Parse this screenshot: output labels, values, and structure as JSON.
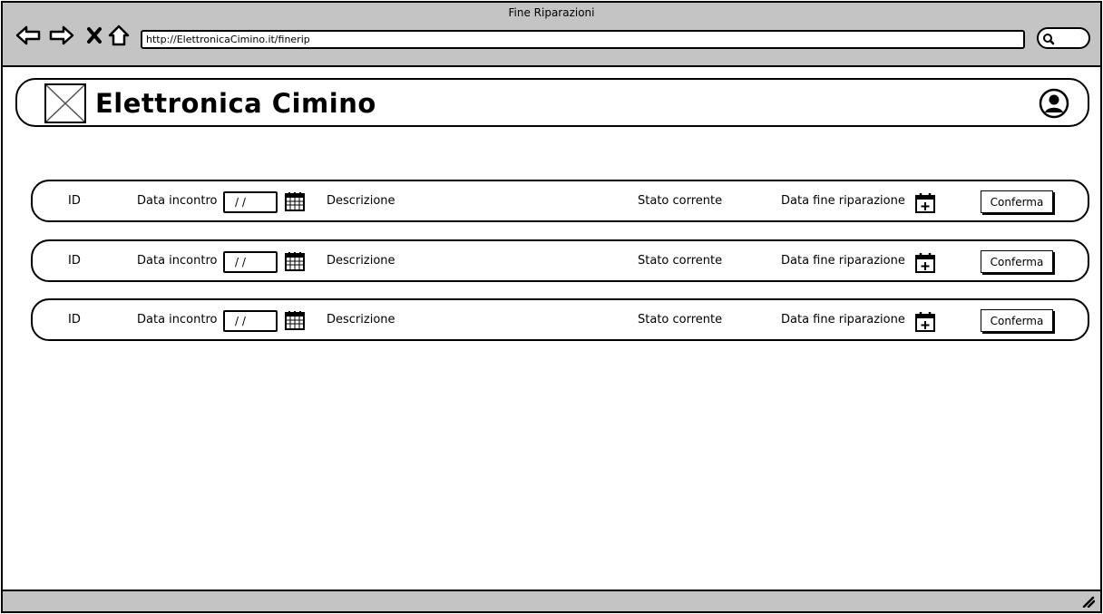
{
  "window": {
    "title": "Fine Riparazioni"
  },
  "browser": {
    "url": "http://ElettronicaCimino.it/finerip",
    "icons": [
      "back-arrow-icon",
      "forward-arrow-icon",
      "close-x-icon",
      "home-icon",
      "search-icon"
    ]
  },
  "header": {
    "brand": "Elettronica Cimino",
    "logo": "image-placeholder-icon",
    "user": "user-avatar-icon"
  },
  "rows": [
    {
      "id": "ID",
      "date_label": "Data incontro",
      "date_value": "/ /",
      "description": "Descrizione",
      "status": "Stato corrente",
      "end_date_label": "Data fine riparazione",
      "confirm": "Conferma"
    },
    {
      "id": "ID",
      "date_label": "Data incontro",
      "date_value": "/ /",
      "description": "Descrizione",
      "status": "Stato corrente",
      "end_date_label": "Data fine riparazione",
      "confirm": "Conferma"
    },
    {
      "id": "ID",
      "date_label": "Data incontro",
      "date_value": "/ /",
      "description": "Descrizione",
      "status": "Stato corrente",
      "end_date_label": "Data fine riparazione",
      "confirm": "Conferma"
    }
  ],
  "colors": {
    "chrome": "#c4c4c4",
    "ink": "#000000",
    "background": "#ffffff"
  }
}
